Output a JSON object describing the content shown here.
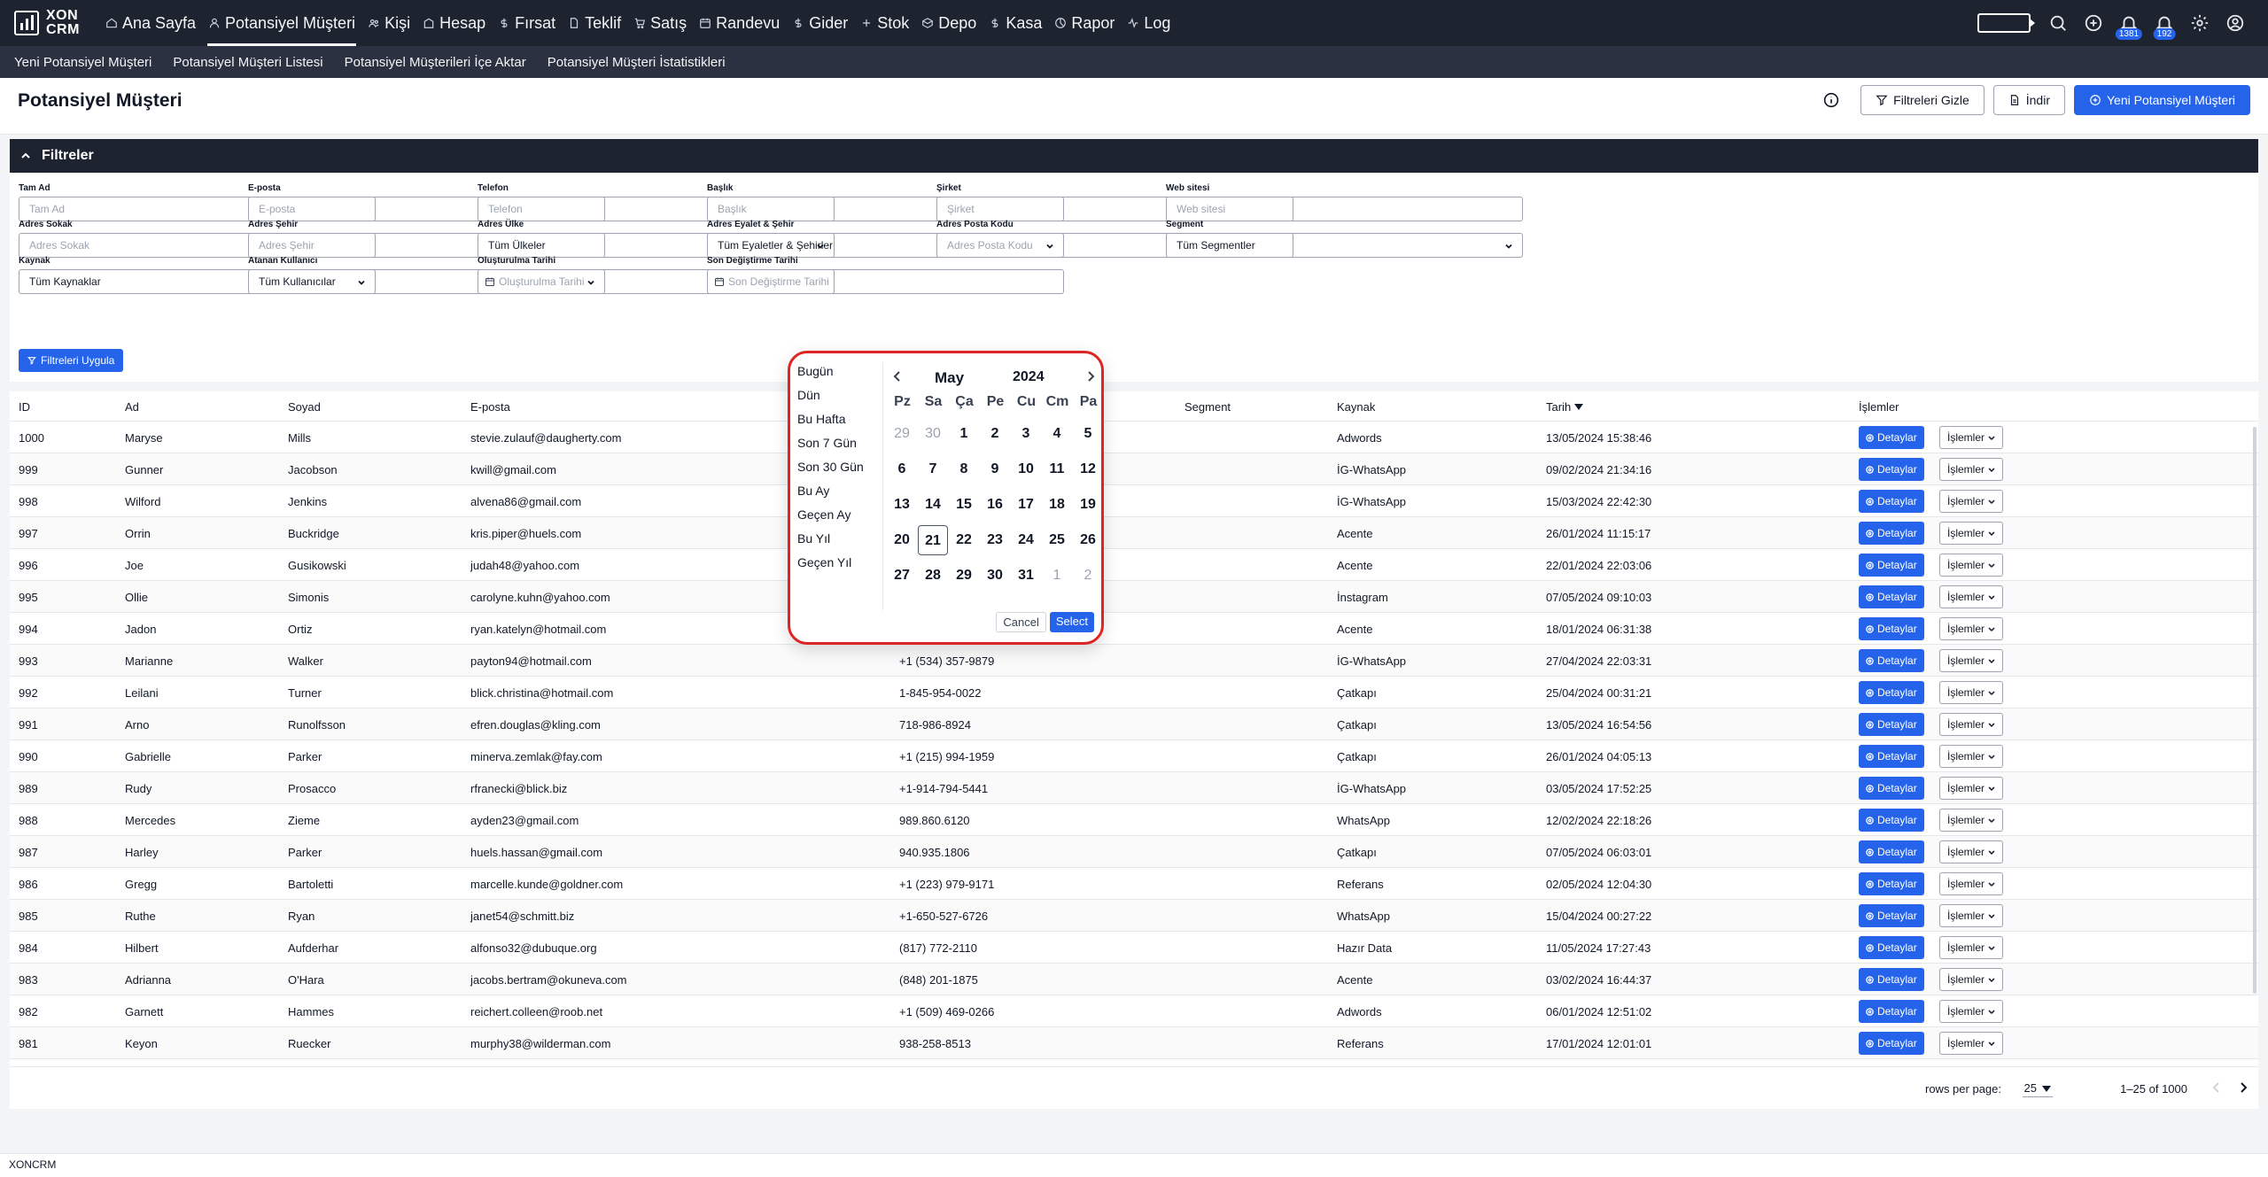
{
  "app": {
    "logo_line1": "XON",
    "logo_line2": "CRM",
    "footer_brand": "XONCRM"
  },
  "nav": [
    {
      "label": "Ana Sayfa",
      "icon": "home-icon"
    },
    {
      "label": "Potansiyel Müşteri",
      "icon": "user-icon"
    },
    {
      "label": "Kişi",
      "icon": "users-icon"
    },
    {
      "label": "Hesap",
      "icon": "building-icon"
    },
    {
      "label": "Fırsat",
      "icon": "dollar-icon"
    },
    {
      "label": "Teklif",
      "icon": "document-icon"
    },
    {
      "label": "Satış",
      "icon": "cart-icon"
    },
    {
      "label": "Randevu",
      "icon": "calendar-icon"
    },
    {
      "label": "Gider",
      "icon": "dollar-icon"
    },
    {
      "label": "Stok",
      "icon": "plus-icon"
    },
    {
      "label": "Depo",
      "icon": "box-icon"
    },
    {
      "label": "Kasa",
      "icon": "dollar-icon"
    },
    {
      "label": "Rapor",
      "icon": "chart-icon"
    },
    {
      "label": "Log",
      "icon": "activity-icon"
    }
  ],
  "notifications": {
    "count1": "1381",
    "count2": "192"
  },
  "subnav": [
    "Yeni Potansiyel Müşteri",
    "Potansiyel Müşteri Listesi",
    "Potansiyel Müşterileri İçe Aktar",
    "Potansiyel Müşteri İstatistikleri"
  ],
  "header": {
    "title": "Potansiyel Müşteri",
    "hide_filters": "Filtreleri Gizle",
    "download": "İndir",
    "new_lead": "Yeni Potansiyel Müşteri"
  },
  "filters": {
    "title": "Filtreler",
    "apply": "Filtreleri Uygula",
    "fields": [
      {
        "label": "Tam Ad",
        "value": "Tam Ad",
        "type": "input"
      },
      {
        "label": "E-posta",
        "value": "E-posta",
        "type": "input"
      },
      {
        "label": "Telefon",
        "value": "Telefon",
        "type": "input"
      },
      {
        "label": "Başlık",
        "value": "Başlık",
        "type": "input"
      },
      {
        "label": "Şirket",
        "value": "Şirket",
        "type": "input"
      },
      {
        "label": "Web sitesi",
        "value": "Web sitesi",
        "type": "input"
      },
      {
        "label": "Adres Sokak",
        "value": "Adres Sokak",
        "type": "input"
      },
      {
        "label": "Adres Şehir",
        "value": "Adres Şehir",
        "type": "input"
      },
      {
        "label": "Adres Ülke",
        "value": "Tüm Ülkeler",
        "type": "select"
      },
      {
        "label": "Adres Eyalet & Şehir",
        "value": "Tüm Eyaletler & Şehirler",
        "type": "select"
      },
      {
        "label": "Adres Posta Kodu",
        "value": "Adres Posta Kodu",
        "type": "input"
      },
      {
        "label": "Segment",
        "value": "Tüm Segmentler",
        "type": "select"
      },
      {
        "label": "Kaynak",
        "value": "Tüm Kaynaklar",
        "type": "select"
      },
      {
        "label": "Atanan Kullanıcı",
        "value": "Tüm Kullanıcılar",
        "type": "select"
      },
      {
        "label": "Oluşturulma Tarihi",
        "value": "Oluşturulma Tarihi",
        "type": "date"
      },
      {
        "label": "Son Değiştirme Tarihi",
        "value": "Son Değiştirme Tarihi",
        "type": "date"
      }
    ]
  },
  "table": {
    "columns": [
      "ID",
      "Ad",
      "Soyad",
      "E-posta",
      "Segment",
      "Kaynak",
      "Tarih",
      "İşlemler"
    ],
    "details_label": "Detaylar",
    "actions_label": "İşlemler",
    "rows": [
      {
        "id": "1000",
        "first": "Maryse",
        "last": "Mills",
        "email": "stevie.zulauf@daugherty.com",
        "phone": "",
        "source": "Adwords",
        "date": "13/05/2024 15:38:46"
      },
      {
        "id": "999",
        "first": "Gunner",
        "last": "Jacobson",
        "email": "kwill@gmail.com",
        "phone": "",
        "source": "İG-WhatsApp",
        "date": "09/02/2024 21:34:16"
      },
      {
        "id": "998",
        "first": "Wilford",
        "last": "Jenkins",
        "email": "alvena86@gmail.com",
        "phone": "",
        "source": "İG-WhatsApp",
        "date": "15/03/2024 22:42:30"
      },
      {
        "id": "997",
        "first": "Orrin",
        "last": "Buckridge",
        "email": "kris.piper@huels.com",
        "phone": "",
        "source": "Acente",
        "date": "26/01/2024 11:15:17"
      },
      {
        "id": "996",
        "first": "Joe",
        "last": "Gusikowski",
        "email": "judah48@yahoo.com",
        "phone": "",
        "source": "Acente",
        "date": "22/01/2024 22:03:06"
      },
      {
        "id": "995",
        "first": "Ollie",
        "last": "Simonis",
        "email": "carolyne.kuhn@yahoo.com",
        "phone": "",
        "source": "İnstagram",
        "date": "07/05/2024 09:10:03"
      },
      {
        "id": "994",
        "first": "Jadon",
        "last": "Ortiz",
        "email": "ryan.katelyn@hotmail.com",
        "phone": "",
        "source": "Acente",
        "date": "18/01/2024 06:31:38"
      },
      {
        "id": "993",
        "first": "Marianne",
        "last": "Walker",
        "email": "payton94@hotmail.com",
        "phone": "+1 (534) 357-9879",
        "source": "İG-WhatsApp",
        "date": "27/04/2024 22:03:31"
      },
      {
        "id": "992",
        "first": "Leilani",
        "last": "Turner",
        "email": "blick.christina@hotmail.com",
        "phone": "1-845-954-0022",
        "source": "Çatkapı",
        "date": "25/04/2024 00:31:21"
      },
      {
        "id": "991",
        "first": "Arno",
        "last": "Runolfsson",
        "email": "efren.douglas@kling.com",
        "phone": "718-986-8924",
        "source": "Çatkapı",
        "date": "13/05/2024 16:54:56"
      },
      {
        "id": "990",
        "first": "Gabrielle",
        "last": "Parker",
        "email": "minerva.zemlak@fay.com",
        "phone": "+1 (215) 994-1959",
        "source": "Çatkapı",
        "date": "26/01/2024 04:05:13"
      },
      {
        "id": "989",
        "first": "Rudy",
        "last": "Prosacco",
        "email": "rfranecki@blick.biz",
        "phone": "+1-914-794-5441",
        "source": "İG-WhatsApp",
        "date": "03/05/2024 17:52:25"
      },
      {
        "id": "988",
        "first": "Mercedes",
        "last": "Zieme",
        "email": "ayden23@gmail.com",
        "phone": "989.860.6120",
        "source": "WhatsApp",
        "date": "12/02/2024 22:18:26"
      },
      {
        "id": "987",
        "first": "Harley",
        "last": "Parker",
        "email": "huels.hassan@gmail.com",
        "phone": "940.935.1806",
        "source": "Çatkapı",
        "date": "07/05/2024 06:03:01"
      },
      {
        "id": "986",
        "first": "Gregg",
        "last": "Bartoletti",
        "email": "marcelle.kunde@goldner.com",
        "phone": "+1 (223) 979-9171",
        "source": "Referans",
        "date": "02/05/2024 12:04:30"
      },
      {
        "id": "985",
        "first": "Ruthe",
        "last": "Ryan",
        "email": "janet54@schmitt.biz",
        "phone": "+1-650-527-6726",
        "source": "WhatsApp",
        "date": "15/04/2024 00:27:22"
      },
      {
        "id": "984",
        "first": "Hilbert",
        "last": "Aufderhar",
        "email": "alfonso32@dubuque.org",
        "phone": "(817) 772-2110",
        "source": "Hazır Data",
        "date": "11/05/2024 17:27:43"
      },
      {
        "id": "983",
        "first": "Adrianna",
        "last": "O'Hara",
        "email": "jacobs.bertram@okuneva.com",
        "phone": "(848) 201-1875",
        "source": "Acente",
        "date": "03/02/2024 16:44:37"
      },
      {
        "id": "982",
        "first": "Garnett",
        "last": "Hammes",
        "email": "reichert.colleen@roob.net",
        "phone": "+1 (509) 469-0266",
        "source": "Adwords",
        "date": "06/01/2024 12:51:02"
      },
      {
        "id": "981",
        "first": "Keyon",
        "last": "Ruecker",
        "email": "murphy38@wilderman.com",
        "phone": "938-258-8513",
        "source": "Referans",
        "date": "17/01/2024 12:01:01"
      }
    ]
  },
  "pagination": {
    "rows_per_page_label": "rows per page:",
    "rows_per_page": "25",
    "range": "1–25 of 1000"
  },
  "datepicker": {
    "presets": [
      "Bugün",
      "Dün",
      "Bu Hafta",
      "Son 7 Gün",
      "Son 30 Gün",
      "Bu Ay",
      "Geçen Ay",
      "Bu Yıl",
      "Geçen Yıl"
    ],
    "month": "May",
    "year": "2024",
    "weekdays": [
      "Pz",
      "Sa",
      "Ça",
      "Pe",
      "Cu",
      "Cm",
      "Pa"
    ],
    "weeks": [
      [
        {
          "d": "29",
          "m": true
        },
        {
          "d": "30",
          "m": true
        },
        {
          "d": "1"
        },
        {
          "d": "2"
        },
        {
          "d": "3"
        },
        {
          "d": "4"
        },
        {
          "d": "5"
        }
      ],
      [
        {
          "d": "6"
        },
        {
          "d": "7"
        },
        {
          "d": "8"
        },
        {
          "d": "9"
        },
        {
          "d": "10"
        },
        {
          "d": "11"
        },
        {
          "d": "12"
        }
      ],
      [
        {
          "d": "13"
        },
        {
          "d": "14"
        },
        {
          "d": "15"
        },
        {
          "d": "16"
        },
        {
          "d": "17"
        },
        {
          "d": "18"
        },
        {
          "d": "19"
        }
      ],
      [
        {
          "d": "20"
        },
        {
          "d": "21",
          "s": true
        },
        {
          "d": "22"
        },
        {
          "d": "23"
        },
        {
          "d": "24"
        },
        {
          "d": "25"
        },
        {
          "d": "26"
        }
      ],
      [
        {
          "d": "27"
        },
        {
          "d": "28"
        },
        {
          "d": "29"
        },
        {
          "d": "30"
        },
        {
          "d": "31"
        },
        {
          "d": "1",
          "m": true
        },
        {
          "d": "2",
          "m": true
        }
      ]
    ],
    "cancel": "Cancel",
    "select": "Select"
  },
  "colors": {
    "nav_bg": "#1e2330",
    "subnav_bg": "#2b3140",
    "primary": "#2563eb",
    "picker_outline": "#dc2626"
  }
}
